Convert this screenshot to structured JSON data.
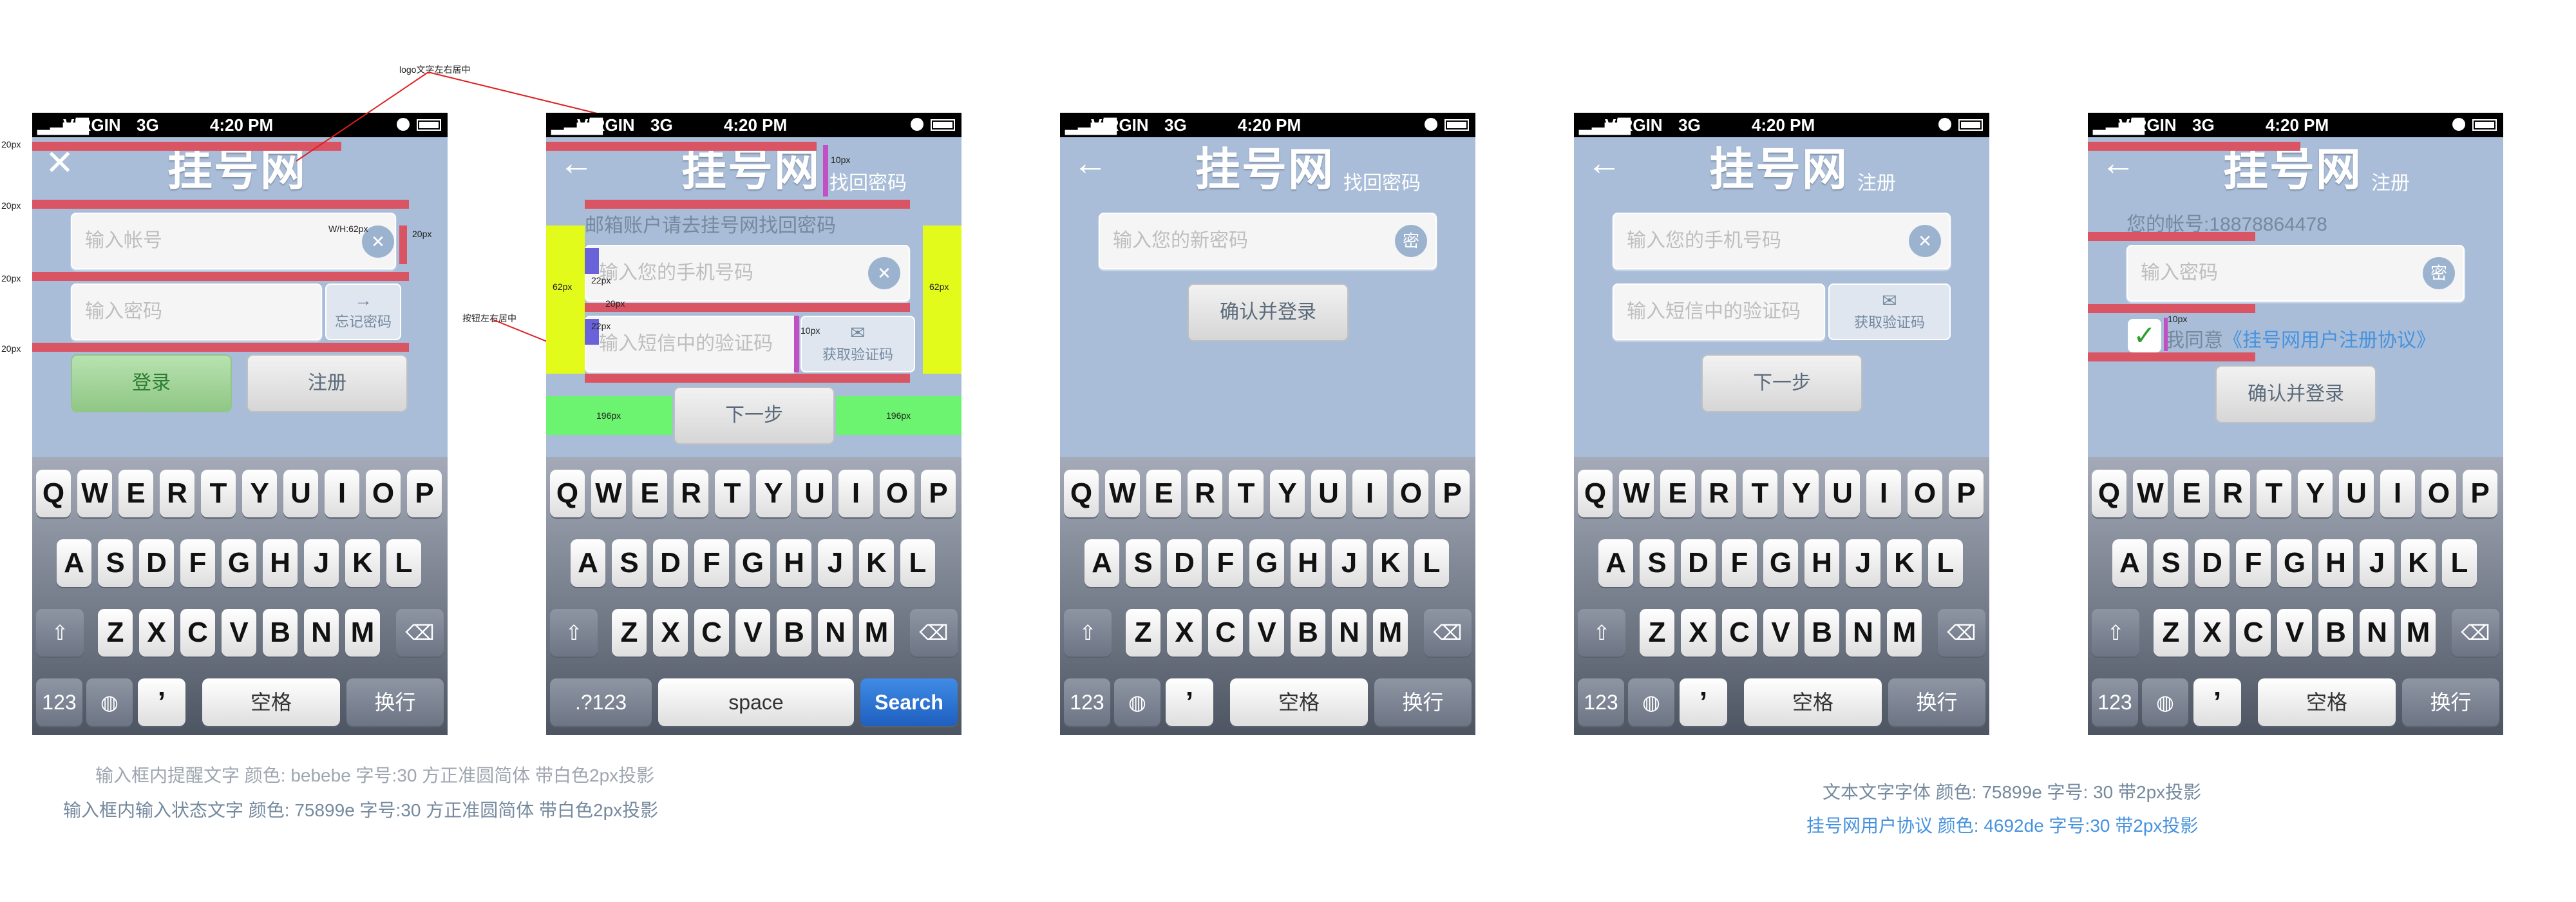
{
  "status_bar": {
    "carrier": "VIRGIN",
    "network": "3G",
    "time": "4:20 PM"
  },
  "screens": {
    "login": {
      "logo": "挂号网",
      "account_placeholder": "输入帐号",
      "password_placeholder": "输入密码",
      "forgot_password": "忘记密码",
      "login_button": "登录",
      "register_button": "注册"
    },
    "recover": {
      "logo": "挂号网",
      "subtitle": "找回密码",
      "hint": "邮箱账户请去挂号网找回密码",
      "phone_placeholder": "输入您的手机号码",
      "code_placeholder": "输入短信中的验证码",
      "get_code": "获取验证码",
      "next_button": "下一步"
    },
    "new_password": {
      "logo": "挂号网",
      "subtitle": "找回密码",
      "password_placeholder": "输入您的新密码",
      "confirm_button": "确认并登录"
    },
    "register": {
      "logo": "挂号网",
      "subtitle": "注册",
      "phone_placeholder": "输入您的手机号码",
      "code_placeholder": "输入短信中的验证码",
      "get_code": "获取验证码",
      "next_button": "下一步"
    },
    "register_password": {
      "logo": "挂号网",
      "subtitle": "注册",
      "account_label": "您的帐号:18878864478",
      "password_placeholder": "输入密码",
      "agree_prefix": "我同意",
      "agreement_link": "《挂号网用户注册协议》",
      "confirm_button": "确认并登录"
    }
  },
  "keyboard": {
    "row1": [
      "Q",
      "W",
      "E",
      "R",
      "T",
      "Y",
      "U",
      "I",
      "O",
      "P"
    ],
    "row2": [
      "A",
      "S",
      "D",
      "F",
      "G",
      "H",
      "J",
      "K",
      "L"
    ],
    "row3": [
      "Z",
      "X",
      "C",
      "V",
      "B",
      "N",
      "M"
    ],
    "cn_123": "123",
    "cn_comma": "’",
    "cn_space": "空格",
    "cn_return": "换行",
    "en_123": ".?123",
    "en_space": "space",
    "en_search": "Search"
  },
  "annotations": {
    "px20": "20px",
    "logo_center": "logo文字左右居中",
    "wh62": "W/H:62px",
    "px10": "10px",
    "px62": "62px",
    "px22": "22px",
    "px196": "196px",
    "button_center": "按钮左右居中"
  },
  "specs": {
    "placeholder_text": "输入框内提醒文字    颜色: bebebe  字号:30  方正准圆简体  带白色2px投影",
    "input_text": "输入框内输入状态文字    颜色: 75899e  字号:30  方正准圆简体  带白色2px投影",
    "body_text": "文本文字字体     颜色: 75899e  字号: 30  带2px投影",
    "agreement_text": "挂号网用户协议   颜色:  4692de  字号:30  带2px投影"
  },
  "colors": {
    "placeholder": "#bebebe",
    "input_text": "#75899e",
    "link": "#4692de",
    "annotation_red": "#d95563",
    "annotation_magenta": "#c24fc4",
    "annotation_yellow": "#e3fb1b",
    "annotation_green": "#6cf36f"
  },
  "icons": [
    "close-icon",
    "back-arrow-icon",
    "clear-icon",
    "key-icon",
    "envelope-icon",
    "shift-icon",
    "backspace-icon",
    "globe-icon",
    "checkmark-icon",
    "forward-arrow-icon"
  ]
}
